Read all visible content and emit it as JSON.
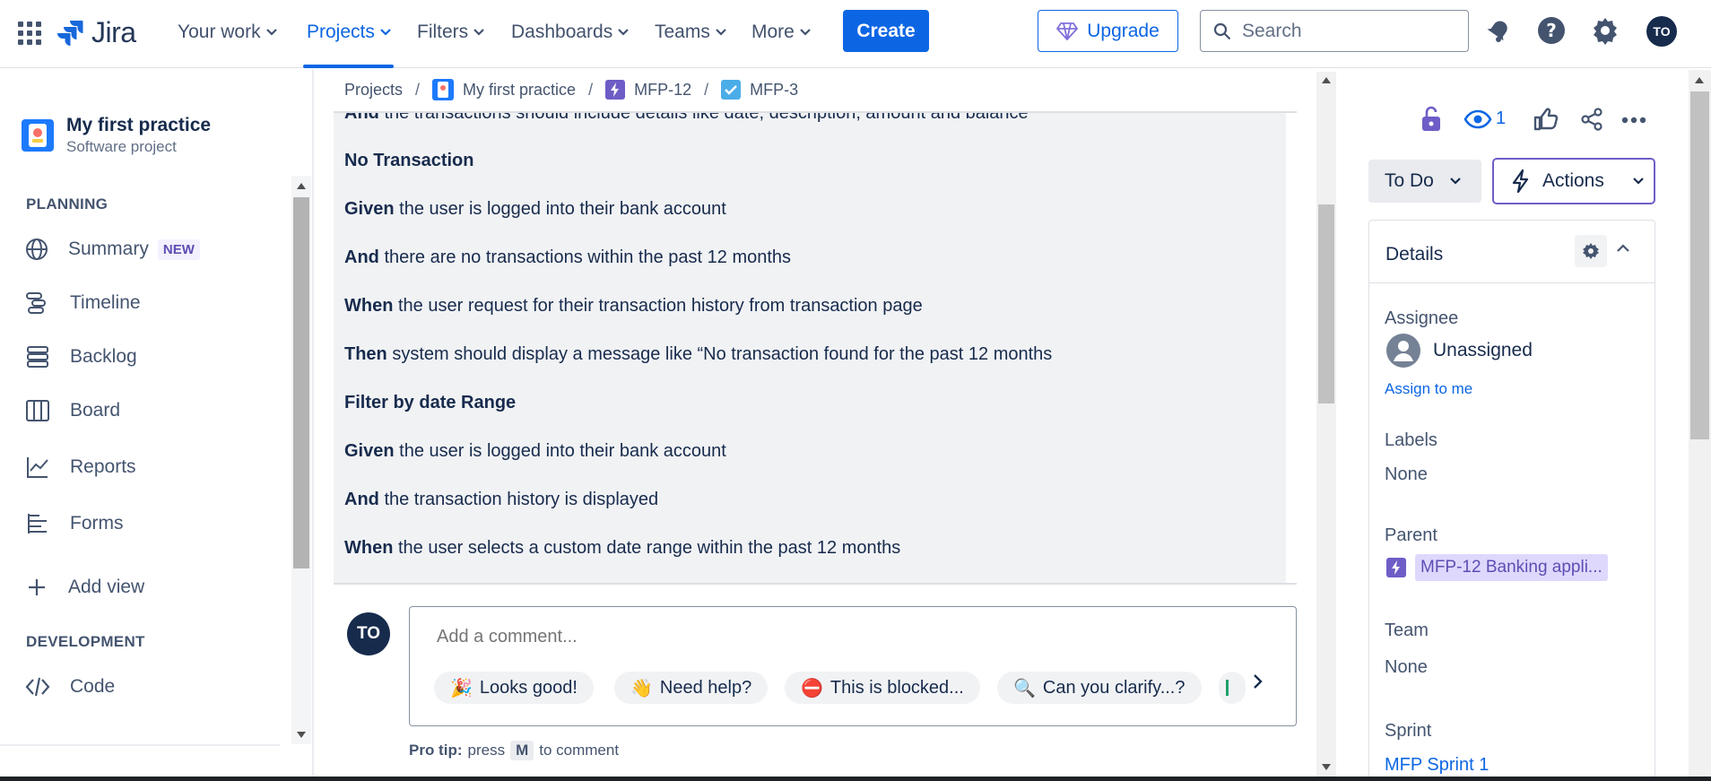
{
  "nav": {
    "logo": "Jira",
    "items": [
      {
        "label": "Your work"
      },
      {
        "label": "Projects"
      },
      {
        "label": "Filters"
      },
      {
        "label": "Dashboards"
      },
      {
        "label": "Teams"
      },
      {
        "label": "More"
      }
    ],
    "create": "Create",
    "upgrade": "Upgrade",
    "search_placeholder": "Search",
    "avatar": "TO"
  },
  "sidebar": {
    "project_name": "My first practice",
    "project_type": "Software project",
    "planning_label": "PLANNING",
    "items": [
      {
        "label": "Summary",
        "badge": "NEW",
        "icon": "globe-icon"
      },
      {
        "label": "Timeline",
        "icon": "timeline-icon"
      },
      {
        "label": "Backlog",
        "icon": "backlog-icon"
      },
      {
        "label": "Board",
        "icon": "board-icon"
      },
      {
        "label": "Reports",
        "icon": "reports-icon"
      },
      {
        "label": "Forms",
        "icon": "forms-icon"
      },
      {
        "label": "Add view",
        "icon": "plus-icon"
      }
    ],
    "development_label": "DEVELOPMENT",
    "dev_items": [
      {
        "label": "Code",
        "icon": "code-icon"
      }
    ]
  },
  "breadcrumb": [
    "Projects",
    "My first practice",
    "MFP-12",
    "MFP-3"
  ],
  "description": [
    {
      "bold": "And",
      "text": " the transactions should include details like date, description, amount and balance"
    },
    {
      "bold": "No Transaction",
      "text": ""
    },
    {
      "bold": "Given",
      "text": " the user is logged into their bank account"
    },
    {
      "bold": "And",
      "text": " there are no transactions within the past 12 months"
    },
    {
      "bold": "When",
      "text": " the user request for their transaction history from transaction page"
    },
    {
      "bold": "Then",
      "text": " system should display a message like “No transaction found for the past 12 months"
    },
    {
      "bold": "Filter by date Range",
      "text": ""
    },
    {
      "bold": "Given",
      "text": " the user is logged into their bank account"
    },
    {
      "bold": "And",
      "text": " the transaction history is displayed"
    },
    {
      "bold": "When",
      "text": " the user selects a custom date range within the past 12 months"
    }
  ],
  "comment": {
    "avatar": "TO",
    "placeholder": "Add a comment...",
    "chips": [
      {
        "emoji": "🎉",
        "label": "Looks good!"
      },
      {
        "emoji": "👋",
        "label": "Need help?"
      },
      {
        "emoji": "⛔",
        "label": "This is blocked..."
      },
      {
        "emoji": "🔍",
        "label": "Can you clarify...?"
      }
    ],
    "protip_label": "Pro tip:",
    "protip_press": "press",
    "protip_key": "M",
    "protip_suffix": "to comment"
  },
  "issue_panel": {
    "watch_count": "1",
    "status": "To Do",
    "actions": "Actions",
    "details_title": "Details",
    "assignee_label": "Assignee",
    "assignee_value": "Unassigned",
    "assign_to_me": "Assign to me",
    "labels_label": "Labels",
    "labels_value": "None",
    "parent_label": "Parent",
    "parent_value": "MFP-12 Banking appli...",
    "team_label": "Team",
    "team_value": "None",
    "sprint_label": "Sprint",
    "sprint_value": "MFP Sprint 1"
  },
  "colors": {
    "accent": "#0c66e4",
    "epic": "#6e5dc6",
    "text": "#172b4d"
  }
}
